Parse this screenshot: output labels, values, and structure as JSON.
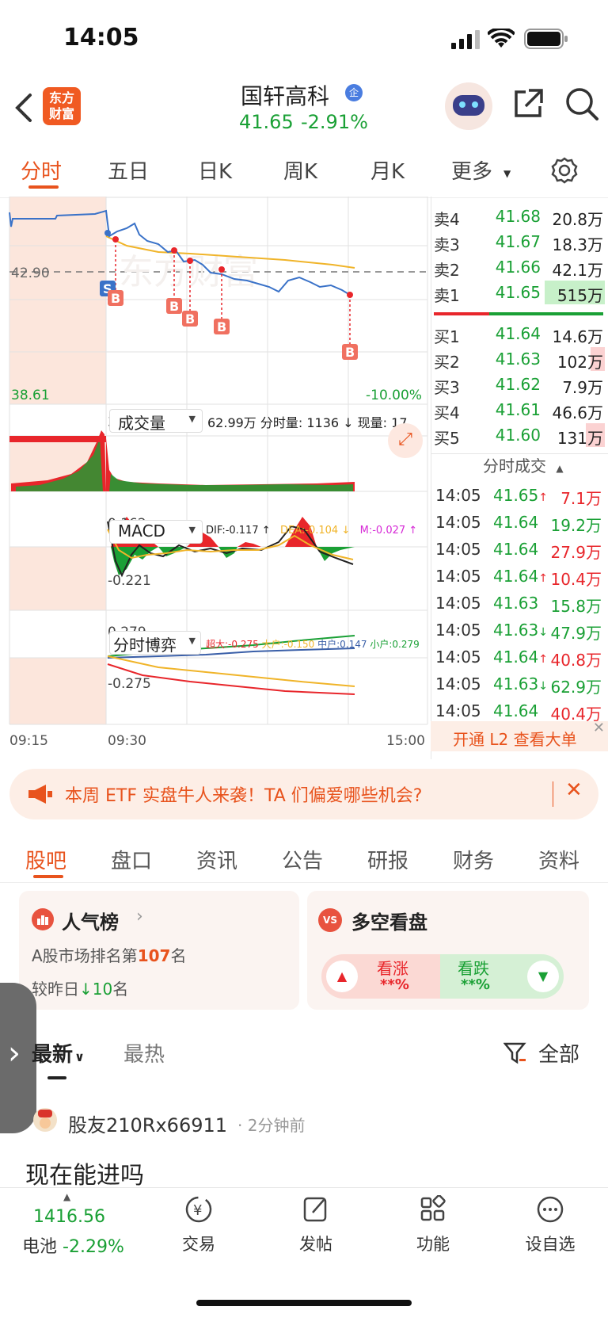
{
  "status_bar": {
    "time": "14:05"
  },
  "header": {
    "logo_text_1": "东方",
    "logo_text_2": "财富",
    "stock_name": "国轩高科",
    "badge": "企",
    "price": "41.65",
    "change_pct": "-2.91%"
  },
  "chart_tabs": [
    "分时",
    "五日",
    "日K",
    "周K",
    "月K",
    "更多"
  ],
  "intraday": {
    "ref_price": "42.90",
    "low_label": "38.61",
    "low_pct": "-10.00%",
    "time_labels": [
      "09:15",
      "09:30",
      "15:00"
    ],
    "markers": [
      "S",
      "B",
      "B",
      "B",
      "B",
      "B"
    ],
    "watermark": "东方财富"
  },
  "volume_panel": {
    "title": "成交量",
    "summary": "62.99万 分时量: 1136 ↓ 现量: 17",
    "max_label": "35192"
  },
  "macd_panel": {
    "title": "MACD",
    "dif": "DIF:-0.117 ↑",
    "dea": "DEA:-0.104 ↓",
    "m": "M:-0.027 ↑",
    "top_label": "0.162",
    "bottom_label": "-0.221"
  },
  "game_panel": {
    "title": "分时博弈",
    "super": "超大:-0.275",
    "large": "大户:-0.150",
    "mid": "中户:0.147",
    "small": "小户:0.279",
    "top_label": "0.279",
    "bottom_label": "-0.275"
  },
  "order_book": {
    "asks": [
      {
        "label": "卖4",
        "price": "41.68",
        "vol": "20.8万"
      },
      {
        "label": "卖3",
        "price": "41.67",
        "vol": "18.3万"
      },
      {
        "label": "卖2",
        "price": "41.66",
        "vol": "42.1万"
      },
      {
        "label": "卖1",
        "price": "41.65",
        "vol": "515万"
      }
    ],
    "bids": [
      {
        "label": "买1",
        "price": "41.64",
        "vol": "14.6万"
      },
      {
        "label": "买2",
        "price": "41.63",
        "vol": "102万"
      },
      {
        "label": "买3",
        "price": "41.62",
        "vol": "7.9万"
      },
      {
        "label": "买4",
        "price": "41.61",
        "vol": "46.6万"
      },
      {
        "label": "买5",
        "price": "41.60",
        "vol": "131万"
      }
    ]
  },
  "ticks": {
    "title": "分时成交",
    "rows": [
      {
        "time": "14:05",
        "price": "41.65",
        "arrow": "↑",
        "vol": "7.1万",
        "dir": "up"
      },
      {
        "time": "14:05",
        "price": "41.64",
        "arrow": "",
        "vol": "19.2万",
        "dir": "dn"
      },
      {
        "time": "14:05",
        "price": "41.64",
        "arrow": "",
        "vol": "27.9万",
        "dir": "up"
      },
      {
        "time": "14:05",
        "price": "41.64",
        "arrow": "↑",
        "vol": "10.4万",
        "dir": "up"
      },
      {
        "time": "14:05",
        "price": "41.63",
        "arrow": "",
        "vol": "15.8万",
        "dir": "dn"
      },
      {
        "time": "14:05",
        "price": "41.63",
        "arrow": "↓",
        "vol": "47.9万",
        "dir": "dn"
      },
      {
        "time": "14:05",
        "price": "41.64",
        "arrow": "↑",
        "vol": "40.8万",
        "dir": "up"
      },
      {
        "time": "14:05",
        "price": "41.63",
        "arrow": "↓",
        "vol": "62.9万",
        "dir": "dn"
      },
      {
        "time": "14:05",
        "price": "41.64",
        "arrow": "",
        "vol": "40.4万",
        "dir": "up"
      }
    ],
    "l2_promo": "开通 L2 查看大单"
  },
  "banner": {
    "text": "本周 ETF 实盘牛人来袭！TA 们偏爱哪些机会?"
  },
  "section_tabs": [
    "股吧",
    "盘口",
    "资讯",
    "公告",
    "研报",
    "财务",
    "资料"
  ],
  "popularity": {
    "title": "人气榜",
    "rank_prefix": "A股市场排名第",
    "rank": "107",
    "rank_suffix": "名",
    "change_prefix": "较昨日",
    "change": "10",
    "change_suffix": "名"
  },
  "sentiment": {
    "title": "多空看盘",
    "bull_label": "看涨",
    "bull_val": "**%",
    "bear_label": "看跌",
    "bear_val": "**%"
  },
  "feed": {
    "sort_latest": "最新",
    "sort_hot": "最热",
    "filter": "全部",
    "post_user": "股友210Rx66911",
    "post_time": "· 2分钟前",
    "post_title": "现在能进吗"
  },
  "bottom_nav": {
    "index_value": "1416.56",
    "index_name": "电池",
    "index_change": "-2.29%",
    "trade": "交易",
    "post": "发帖",
    "func": "功能",
    "watch": "设自选"
  }
}
